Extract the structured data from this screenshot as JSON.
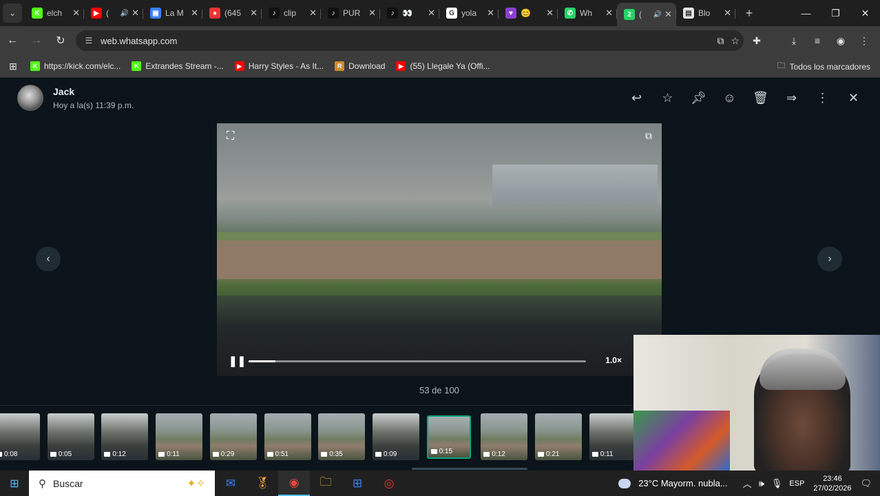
{
  "browser": {
    "tabs": [
      {
        "title": "elch",
        "favicon": "kick",
        "color": "#53fc18",
        "glyph": "K"
      },
      {
        "title": "(",
        "favicon": "youtube",
        "color": "#ff0000",
        "glyph": "▶",
        "audio": "🔊"
      },
      {
        "title": "La M",
        "favicon": "app",
        "color": "#3b82f6",
        "glyph": "▣"
      },
      {
        "title": "(645",
        "favicon": "app",
        "color": "#e33",
        "glyph": "●"
      },
      {
        "title": "clip",
        "favicon": "tiktok",
        "color": "#111",
        "glyph": "♪"
      },
      {
        "title": "PUR",
        "favicon": "tiktok",
        "color": "#111",
        "glyph": "♪"
      },
      {
        "title": "👀",
        "favicon": "tiktok",
        "color": "#111",
        "glyph": "♪"
      },
      {
        "title": "yola",
        "favicon": "google",
        "color": "#ffffff",
        "glyph": "G"
      },
      {
        "title": "😊",
        "favicon": "heart",
        "color": "#8b3fd1",
        "glyph": "♥"
      },
      {
        "title": "Wh",
        "favicon": "whatsapp",
        "color": "#25d366",
        "glyph": "✆"
      },
      {
        "title": "(",
        "favicon": "whatsapp-badge",
        "color": "#25d366",
        "glyph": "2",
        "audio": "🔊"
      },
      {
        "title": "Blo",
        "favicon": "doc",
        "color": "#e3e3e3",
        "glyph": "▤"
      }
    ],
    "active_tab_index": 10,
    "url": "web.whatsapp.com",
    "bookmarks": [
      {
        "label": "https://kick.com/elc...",
        "color": "#53fc18",
        "glyph": "K"
      },
      {
        "label": "Extrandes Stream -...",
        "color": "#53fc18",
        "glyph": "K"
      },
      {
        "label": "Harry Styles - As It...",
        "color": "#ff0000",
        "glyph": "▶"
      },
      {
        "label": "Download",
        "color": "#d08a2a",
        "glyph": "R"
      },
      {
        "label": "(55) Llegale Ya (Offi...",
        "color": "#ff0000",
        "glyph": "▶"
      }
    ],
    "all_bookmarks": "Todos los marcadores"
  },
  "viewer": {
    "sender_name": "Jack",
    "sender_time": "Hoy a la(s) 11:39 p.m.",
    "counter": "53 de 100",
    "speed": "1.0×",
    "progress": 0.08,
    "thumbnails": [
      {
        "duration": "0:08",
        "style": "crowdy"
      },
      {
        "duration": "0:05",
        "style": "crowdy"
      },
      {
        "duration": "0:12",
        "style": "crowdy"
      },
      {
        "duration": "0:11",
        "style": "field"
      },
      {
        "duration": "0:29",
        "style": "field"
      },
      {
        "duration": "0:51",
        "style": "field"
      },
      {
        "duration": "0:35",
        "style": "field"
      },
      {
        "duration": "0:09",
        "style": "crowdy"
      },
      {
        "duration": "0:15",
        "style": "field",
        "selected": true
      },
      {
        "duration": "0:12",
        "style": "field"
      },
      {
        "duration": "0:21",
        "style": "field"
      },
      {
        "duration": "0:11",
        "style": "crowdy"
      }
    ]
  },
  "taskbar": {
    "search_placeholder": "Buscar",
    "weather": "23°C  Mayorm. nubla...",
    "language": "ESP",
    "time": "23:46",
    "date": "27/02/2026"
  }
}
